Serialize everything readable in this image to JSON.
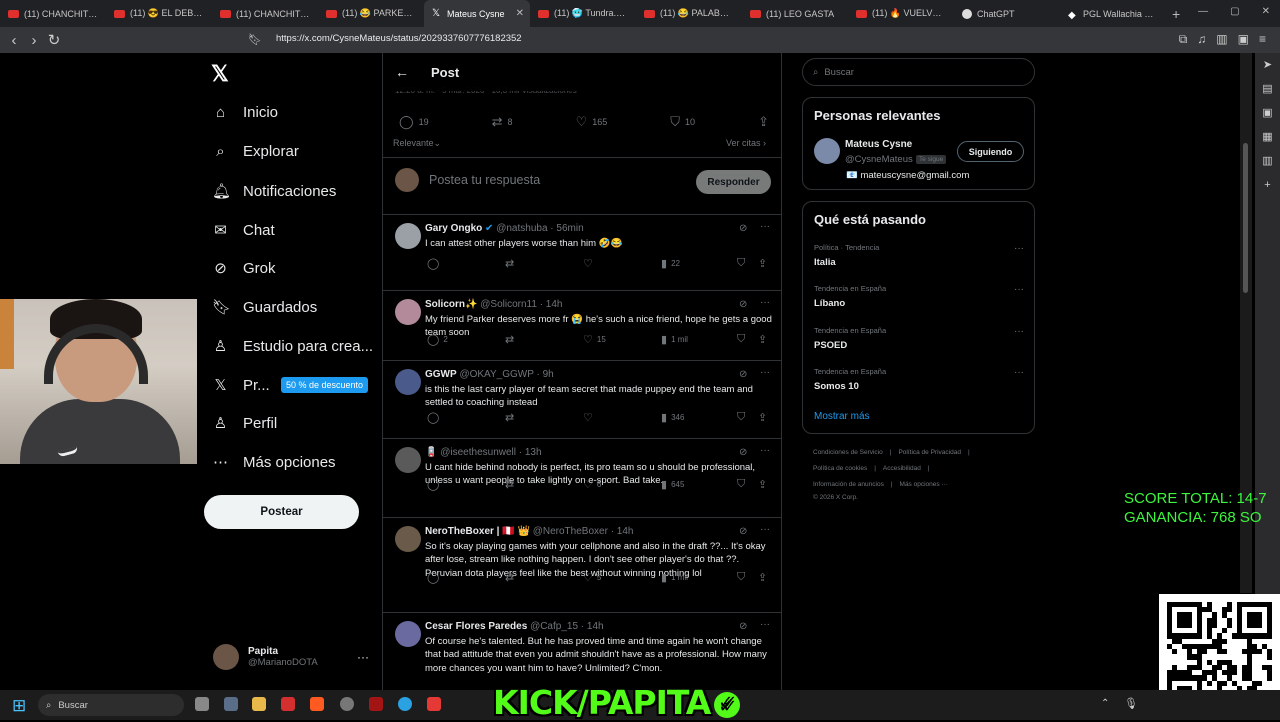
{
  "browser": {
    "tabs": [
      {
        "label": "(11) CHANCHITO DE",
        "fav": "yt"
      },
      {
        "label": "(11) 😎 EL DEBUT DE",
        "fav": "yt"
      },
      {
        "label": "(11) CHANCHITO DE",
        "fav": "yt"
      },
      {
        "label": "(11) 😂 PARKER se",
        "fav": "yt"
      },
      {
        "label": "Mateus Cysne",
        "fav": "x",
        "active": true
      },
      {
        "label": "(11) 🥶 Tundra.Park",
        "fav": "yt"
      },
      {
        "label": "(11) 😂 PALABRAS DE R",
        "fav": "yt"
      },
      {
        "label": "(11) LEO GASTA",
        "fav": "yt"
      },
      {
        "label": "(11) 🔥 VUELVE LA",
        "fav": "yt"
      },
      {
        "label": "ChatGPT",
        "fav": "g"
      },
      {
        "label": "PGL Wallachia Seas",
        "fav": "p"
      }
    ],
    "url": "https://x.com/CysneMateus/status/2029337607776182352"
  },
  "sidebar": {
    "logo": "𝕏",
    "items": [
      {
        "label": "Inicio",
        "icon": "⌂",
        "name": "home"
      },
      {
        "label": "Explorar",
        "icon": "⌕",
        "name": "explore"
      },
      {
        "label": "Notificaciones",
        "icon": "🔔︎",
        "name": "notifications"
      },
      {
        "label": "Chat",
        "icon": "✉",
        "name": "chat"
      },
      {
        "label": "Grok",
        "icon": "⊘",
        "name": "grok"
      },
      {
        "label": "Guardados",
        "icon": "🔖︎",
        "name": "bookmarks"
      },
      {
        "label": "Estudio para crea...",
        "icon": "♙",
        "name": "creator-studio"
      },
      {
        "label": "Pr...",
        "icon": "𝕏",
        "name": "premium"
      },
      {
        "label": "Perfil",
        "icon": "♙",
        "name": "profile"
      },
      {
        "label": "Más opciones",
        "icon": "⋯",
        "name": "more"
      }
    ],
    "promo_badge": "50 % de descuento",
    "post_button": "Postear",
    "account": {
      "name": "Papita",
      "handle": "@MarianoDOTA"
    }
  },
  "post": {
    "header_title": "Post",
    "ghost_meta": "12:20 a. m. · 5 mar. 2026 · 10,3 mil Visualizaciones",
    "stats": {
      "replies": "19",
      "reposts": "8",
      "likes": "165",
      "bookmarks": "10"
    },
    "sort_label": "Relevante⌄",
    "quotes_label": "Ver citas ›",
    "reply_placeholder": "Postea tu respuesta",
    "reply_button": "Responder"
  },
  "replies": [
    {
      "name": "Gary Ongko",
      "verified": true,
      "handle": "@natshuba · 56min",
      "text": "I can attest other players worse than him 🤣😂",
      "replies": "",
      "retweets": "",
      "views": "22",
      "avatar": "#9aa0a6"
    },
    {
      "name": "Solicorn✨",
      "verified": false,
      "handle": "@Solicorn11 · 14h",
      "text": "My friend Parker deserves more fr 😭 he's such a nice friend, hope he gets a good team soon",
      "replies": "2",
      "retweets": "",
      "likes": "15",
      "views": "1 mil",
      "avatar": "#b28a9a"
    },
    {
      "name": "GGWP",
      "verified": false,
      "handle": "@OKAY_GGWP · 9h",
      "text": "is this the last carry player of team secret that made puppey end the team and settled to coaching instead",
      "replies": "",
      "retweets": "",
      "views": "346",
      "avatar": "#4a5a8a"
    },
    {
      "name": "🪫",
      "verified": false,
      "handle": "@iseethesunwell · 13h",
      "text": "U cant hide behind nobody is perfect, its pro team so u should be professional, unless u want people to take lightly on e-sport. Bad take.",
      "replies": "",
      "retweets": "",
      "likes": "6",
      "views": "645",
      "avatar": "#5a5a5a"
    },
    {
      "name": "NeroTheBoxer | 🇵🇪 👑",
      "verified": false,
      "handle": "@NeroTheBoxer · 14h",
      "text": "So it's okay playing games with your cellphone and also in the draft ??... It's okay after lose,  stream like nothing happen. I don't see other player's do that ??. Peruvian dota players feel like the best without winning nothing lol",
      "replies": "",
      "retweets": "",
      "likes": "5",
      "views": "1 mil",
      "avatar": "#6a5a4a"
    },
    {
      "name": "Cesar Flores Paredes",
      "verified": false,
      "handle": "@Cafp_15 · 14h",
      "text": "Of course he's talented. But he has proved time and time again he won't change that bad attitude that even you admit shouldn't have as a professional. How many more chances you want him to have? Unlimited? C'mon.",
      "replies": "",
      "retweets": "",
      "views": "",
      "avatar": "#6a6aa0"
    }
  ],
  "right": {
    "search_placeholder": "Buscar",
    "people_title": "Personas relevantes",
    "person": {
      "name": "Mateus Cysne",
      "handle": "@CysneMateus",
      "badge": "Te sigue",
      "follow": "Siguiendo",
      "bio": "📧 mateuscysne@gmail.com"
    },
    "trends_title": "Qué está pasando",
    "trends": [
      {
        "context": "Política · Tendencia",
        "name": "Italia"
      },
      {
        "context": "Tendencia en España",
        "name": "Líbano"
      },
      {
        "context": "Tendencia en España",
        "name": "PSOED"
      },
      {
        "context": "Tendencia en España",
        "name": "Somos 10"
      }
    ],
    "show_more": "Mostrar más",
    "footer": [
      [
        "Condiciones de Servicio",
        "|",
        "Política de Privacidad",
        "|"
      ],
      [
        "Política de cookies",
        "|",
        "Accesibilidad",
        "|"
      ],
      [
        "Información de anuncios",
        "|",
        "Más opciones ···"
      ],
      [
        "© 2026 X Corp."
      ]
    ]
  },
  "overlay": {
    "score_line1": "SCORE TOTAL: 14-7",
    "score_line2": "GANANCIA: 768 SO",
    "kick_text": "KICK/PAPITA",
    "kick_check": "✓"
  },
  "taskbar": {
    "search_label": "Buscar",
    "lang": "ESP\nLAA"
  },
  "colors": {
    "accent": "#1d9bf0",
    "kick": "#53fc18",
    "score": "#3cf53c"
  }
}
